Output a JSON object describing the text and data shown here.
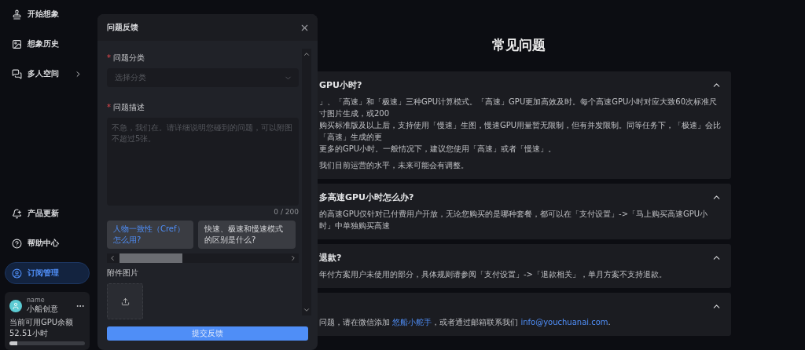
{
  "sidebar": {
    "top_items": [
      {
        "kind": "stamp",
        "label": "开始想象",
        "selected": false,
        "submenu": false
      },
      {
        "kind": "image",
        "label": "想象历史",
        "selected": false,
        "submenu": false
      },
      {
        "kind": "chat",
        "label": "多人空间",
        "selected": false,
        "submenu": true
      }
    ],
    "bottom_items": [
      {
        "kind": "bell",
        "label": "产品更新",
        "selected": false,
        "submenu": false
      },
      {
        "kind": "help",
        "label": "帮助中心",
        "selected": false,
        "submenu": false
      },
      {
        "kind": "user",
        "label": "订阅管理",
        "selected": true,
        "submenu": false
      }
    ],
    "account": {
      "name": "name",
      "team": "小船创意",
      "balance_label": "当前可用GPU余额",
      "balance": "52.51小时",
      "level": 0.1
    }
  },
  "page_title": "常见问题",
  "faq": [
    {
      "title": "GPU小时?",
      "expanded": true,
      "paragraphs": [
        [
          {
            "kind": "text",
            "text": "」、「高速」和「极速」三种GPU计算模式。「高速」GPU更加高效及时。每个高速GPU小时对应大致60次标准尺寸图片生成，或200"
          },
          {
            "kind": "break"
          },
          {
            "kind": "text",
            "text": "购买标准版及以上后，支持使用「慢速」生图，慢速GPU用量暂无限制，但有并发限制。同等任务下，「极速」会比「高速」生成的更"
          },
          {
            "kind": "break"
          },
          {
            "kind": "text",
            "text": "更多的GPU小时。一般情况下，建议您使用「高速」或者「慢速」。"
          }
        ],
        [
          {
            "kind": "text",
            "text": "我们目前运营的水平，未来可能会有调整。"
          }
        ]
      ]
    },
    {
      "title": "多高速GPU小时怎么办?",
      "expanded": true,
      "paragraphs": [
        [
          {
            "kind": "text",
            "text": "的高速GPU仅针对已付费用户开放，无论您购买的是哪种套餐，都可以在「支付设置」->「马上购买高速GPU小时」中单独购买高速"
          }
        ]
      ]
    },
    {
      "title": "退款?",
      "expanded": true,
      "paragraphs": [
        [
          {
            "kind": "text",
            "text": "年付方案用户未使用的部分，具体规则请参阅「支付设置」->「退款相关」，单月方案不支持退款。"
          }
        ]
      ]
    },
    {
      "expanded": true,
      "paragraphs": [
        [
          {
            "kind": "text",
            "text": "问题，请在微信添加 "
          },
          {
            "kind": "link",
            "text": "悠船小舵手"
          },
          {
            "kind": "text",
            "text": "，或者通过邮箱联系我们 "
          },
          {
            "kind": "link",
            "text": "info@youchuanai.com"
          },
          {
            "kind": "text",
            "text": "."
          }
        ]
      ]
    }
  ],
  "modal": {
    "title": "问题反馈",
    "fields": [
      {
        "kind": "select",
        "label": "问题分类",
        "required_mark": "*",
        "placeholder": "选择分类"
      },
      {
        "kind": "textarea",
        "label": "问题描述",
        "required_mark": "*",
        "placeholder": "不急，我们在。请详细说明您碰到的问题，可以附图不超过5张。",
        "counter": "0 / 200"
      }
    ],
    "suggestions": [
      {
        "text": "人物一致性（Cref）怎么用?",
        "selected": true
      },
      {
        "text": "快速、极速和慢速模式的区别是什么?",
        "selected": false
      }
    ],
    "attachment_label": "附件图片",
    "submit": "提交反馈"
  }
}
